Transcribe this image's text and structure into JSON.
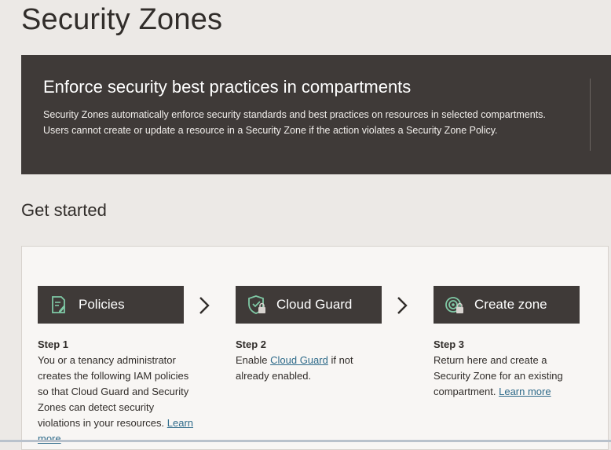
{
  "page": {
    "title": "Security Zones"
  },
  "banner": {
    "heading": "Enforce security best practices in compartments",
    "body": "Security Zones automatically enforce security standards and best practices on resources in selected compartments. Users cannot create or update a resource in a Security Zone if the action violates a Security Zone Policy."
  },
  "get_started": {
    "title": "Get started",
    "steps": [
      {
        "button_label": "Policies",
        "icon": "policy-document-icon",
        "step_label": "Step 1",
        "text_before": "You or a tenancy administrator creates the following IAM policies so that Cloud Guard and Security Zones can detect security violations in your resources.",
        "link": "Learn more",
        "text_after": ""
      },
      {
        "button_label": "Cloud Guard",
        "icon": "shield-lock-icon",
        "step_label": "Step 2",
        "text_before": "Enable",
        "link": "Cloud Guard",
        "text_after": "if not already enabled."
      },
      {
        "button_label": "Create zone",
        "icon": "zone-lock-icon",
        "step_label": "Step 3",
        "text_before": "Return here and create a Security Zone for an existing compartment.",
        "link": "Learn more",
        "text_after": ""
      }
    ]
  },
  "colors": {
    "banner_bg": "#3f3a38",
    "page_bg": "#ece9e6",
    "icon_green": "#7fc9a5",
    "link": "#2f6b8a"
  }
}
